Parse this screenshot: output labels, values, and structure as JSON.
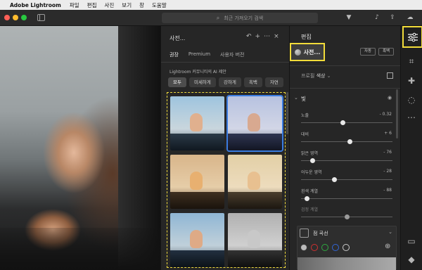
{
  "menubar": {
    "apple": "",
    "app_name": "Adobe Lightroom",
    "items": [
      "파일",
      "편집",
      "사진",
      "보기",
      "창",
      "도움말"
    ]
  },
  "toolbar": {
    "search_placeholder": "최근 가져오기 검색",
    "icons": [
      "filter-icon",
      "bell-icon",
      "share-icon",
      "cloud-icon"
    ]
  },
  "presets_panel": {
    "title": "사전...",
    "tabs": [
      "권장",
      "Premium",
      "사용자 버전"
    ],
    "active_tab": "권장",
    "ai_note": "Lightroom 커뮤니티의 AI 제안",
    "chips": [
      "모두",
      "미세하게",
      "강하게",
      "흑백",
      "자연"
    ],
    "active_chip": "모두",
    "thumb_count": 6,
    "selected_thumb": 1
  },
  "edit_panel": {
    "title": "편집",
    "presets_button": "사전...",
    "auto_button": "자동",
    "bw_button": "흑백",
    "profile_label": "프로필",
    "profile_value": "색상",
    "light_section": "빛",
    "sliders": [
      {
        "label": "노출",
        "value": "- 0.32",
        "level": 0.45
      },
      {
        "label": "대비",
        "value": "+ 6",
        "level": 0.53
      },
      {
        "label": "밝은 영역",
        "value": "- 76",
        "level": 0.12
      },
      {
        "label": "어두운 영역",
        "value": "- 28",
        "level": 0.36
      },
      {
        "label": "흰색 계열",
        "value": "- 88",
        "level": 0.06
      },
      {
        "label": "검정 계열",
        "value": "",
        "level": 0.5
      }
    ],
    "curve_title": "점 곡선",
    "channels": [
      "#3a3a3a",
      "#d03030",
      "#2eaa40",
      "#3266d8",
      "#cccccc"
    ]
  },
  "colors": {
    "highlight": "#f2dc3a",
    "selection": "#3a7ce0"
  }
}
